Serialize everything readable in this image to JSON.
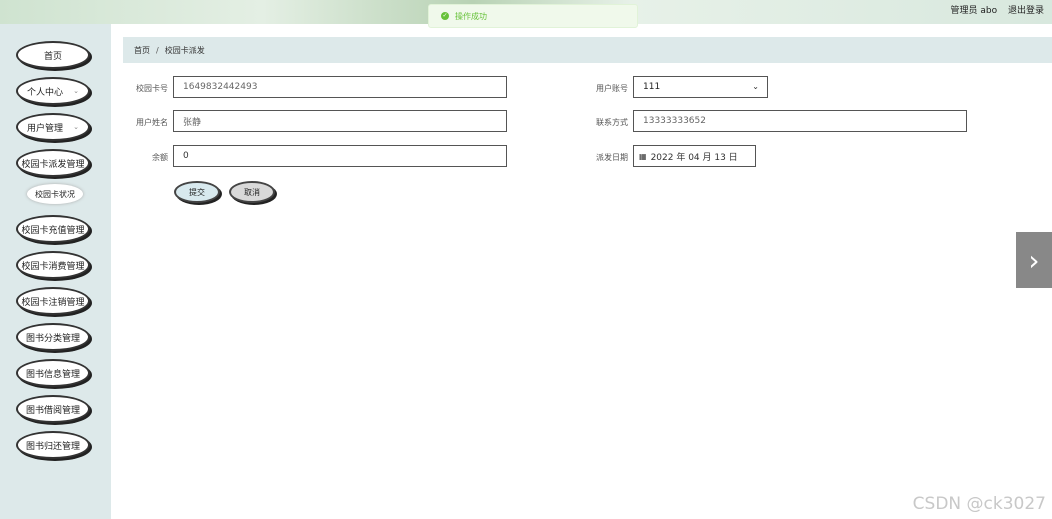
{
  "header": {
    "title": "",
    "user_label": "管理员 abo",
    "logout_label": "退出登录"
  },
  "toast": {
    "text": "操作成功",
    "icon": "check-circle-icon"
  },
  "sidebar": {
    "items": [
      {
        "label": "首页"
      },
      {
        "label": "个人中心"
      },
      {
        "label": "用户管理"
      },
      {
        "label": "校园卡派发管理"
      },
      {
        "label": "校园卡状况"
      },
      {
        "label": "校园卡充值管理"
      },
      {
        "label": "校园卡消费管理"
      },
      {
        "label": "校园卡注销管理"
      },
      {
        "label": "图书分类管理"
      },
      {
        "label": "图书信息管理"
      },
      {
        "label": "图书借阅管理"
      },
      {
        "label": "图书归还管理"
      }
    ]
  },
  "breadcrumb": {
    "home": "首页",
    "separator": "/",
    "current": "校园卡派发"
  },
  "form": {
    "card_no_label": "校园卡号",
    "card_no_value": "1649832442493",
    "account_label": "用户账号",
    "account_value": "111",
    "name_label": "用户姓名",
    "name_value": "张静",
    "phone_label": "联系方式",
    "phone_value": "13333333652",
    "balance_label": "余额",
    "balance_value": "0",
    "date_label": "派发日期",
    "date_value": "2022 年 04 月 13 日",
    "submit_label": "提交",
    "cancel_label": "取消"
  },
  "watermark": "CSDN @ck3027"
}
